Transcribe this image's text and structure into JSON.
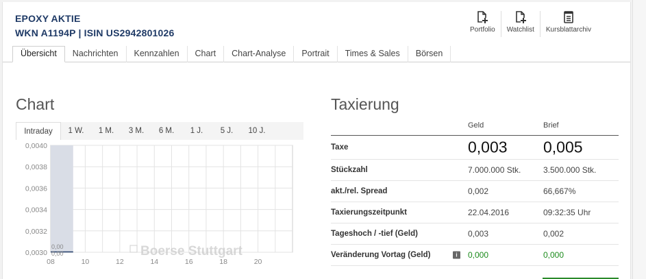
{
  "header": {
    "title": "EPOXY AKTIE",
    "subtitle": "WKN A1194P | ISIN US2942801026",
    "actions": [
      {
        "label": "Portfolio",
        "icon": "add-document-icon"
      },
      {
        "label": "Watchlist",
        "icon": "add-document-icon"
      },
      {
        "label": "Kursblattarchiv",
        "icon": "archive-icon"
      }
    ]
  },
  "tabs": [
    "Übersicht",
    "Nachrichten",
    "Kennzahlen",
    "Chart",
    "Chart-Analyse",
    "Portrait",
    "Times & Sales",
    "Börsen"
  ],
  "active_tab": "Übersicht",
  "chart_section": {
    "heading": "Chart",
    "ranges": [
      "Intraday",
      "1 W.",
      "1 M.",
      "3 M.",
      "6 M.",
      "1 J.",
      "5 J.",
      "10 J."
    ],
    "active_range": "Intraday",
    "watermark": "Boerse Stuttgart"
  },
  "chart_data": {
    "type": "area",
    "x": [
      8,
      9.3
    ],
    "y_labels_at_x": [
      "0,00",
      "0,00"
    ],
    "xticks": [
      "08",
      "10",
      "12",
      "14",
      "16",
      "18",
      "20"
    ],
    "xtick_values": [
      8,
      10,
      12,
      14,
      16,
      18,
      20
    ],
    "yticks": [
      "0,0040",
      "0,0038",
      "0,0036",
      "0,0034",
      "0,0032",
      "0,0030"
    ],
    "ytick_values": [
      0.004,
      0.0038,
      0.0036,
      0.0034,
      0.0032,
      0.003
    ],
    "xlim": [
      8,
      22
    ],
    "ylim": [
      0.003,
      0.004
    ],
    "series": [
      {
        "values": [
          0.004,
          0.004
        ]
      }
    ],
    "grid": true,
    "area_color": "#d9dde6",
    "line_color": "#1f3a66"
  },
  "taxierung": {
    "heading": "Taxierung",
    "col_geld": "Geld",
    "col_brief": "Brief",
    "rows": [
      {
        "label": "Taxe",
        "geld": "0,003",
        "brief": "0,005"
      },
      {
        "label": "Stückzahl",
        "geld": "7.000.000 Stk.",
        "brief": "3.500.000 Stk."
      },
      {
        "label": "akt./rel. Spread",
        "geld": "0,002",
        "brief": "66,667%"
      },
      {
        "label": "Taxierungszeitpunkt",
        "geld": "22.04.2016",
        "brief": "09:32:35 Uhr"
      },
      {
        "label": "Tageshoch / -tief (Geld)",
        "geld": "0,003",
        "brief": "0,002"
      },
      {
        "label": "Veränderung Vortag (Geld)",
        "geld": "0,000",
        "brief": "0,000"
      }
    ],
    "info_icon_label": "i",
    "positive_color": "#1a8a1a"
  }
}
